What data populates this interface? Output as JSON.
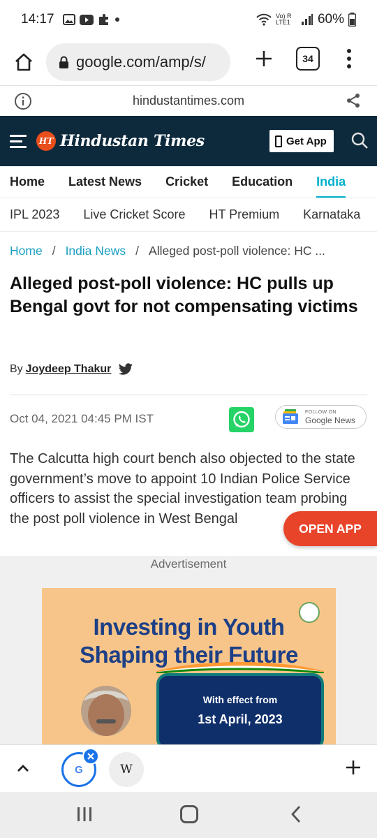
{
  "status": {
    "time": "14:17",
    "network": "Vo) R LTE1",
    "battery": "60%"
  },
  "browser": {
    "url": "google.com/amp/s/",
    "tab_count": "34"
  },
  "amp": {
    "domain": "hindustantimes.com"
  },
  "header": {
    "logo_badge": "HT",
    "logo_text": "Hindustan Times",
    "get_app": "Get App"
  },
  "nav_primary": [
    {
      "label": "Home"
    },
    {
      "label": "Latest News"
    },
    {
      "label": "Cricket"
    },
    {
      "label": "Education"
    },
    {
      "label": "India",
      "active": true
    }
  ],
  "nav_secondary": [
    {
      "label": "IPL 2023"
    },
    {
      "label": "Live Cricket Score"
    },
    {
      "label": "HT Premium"
    },
    {
      "label": "Karnataka"
    }
  ],
  "breadcrumb": {
    "home": "Home",
    "section": "India News",
    "current": "Alleged post-poll violence: HC ...",
    "separator": "/"
  },
  "article": {
    "headline": "Alleged post-poll violence: HC pulls up Bengal govt for not compensating victims",
    "by_label": "By",
    "author": "Joydeep Thakur",
    "date": "Oct 04, 2021 04:45 PM IST",
    "summary": "The Calcutta high court bench also objected to the state government’s move to appoint 10 Indian Police Service officers to assist the special investigation team probing the post poll violence in West Bengal"
  },
  "google_news": {
    "small": "FOLLOW ON",
    "big": "Google News"
  },
  "open_app": "OPEN APP",
  "ad": {
    "label": "Advertisement",
    "title_line1": "Investing in Youth",
    "title_line2": "Shaping their Future",
    "box_line1": "With effect from",
    "box_line2": "1st April, 2023"
  },
  "tab_strip": {
    "google_letter": "G",
    "wiki_letter": "W"
  },
  "colors": {
    "ht_navy": "#0d2a3c",
    "accent": "#00b1cd",
    "open_app": "#e8442a"
  }
}
